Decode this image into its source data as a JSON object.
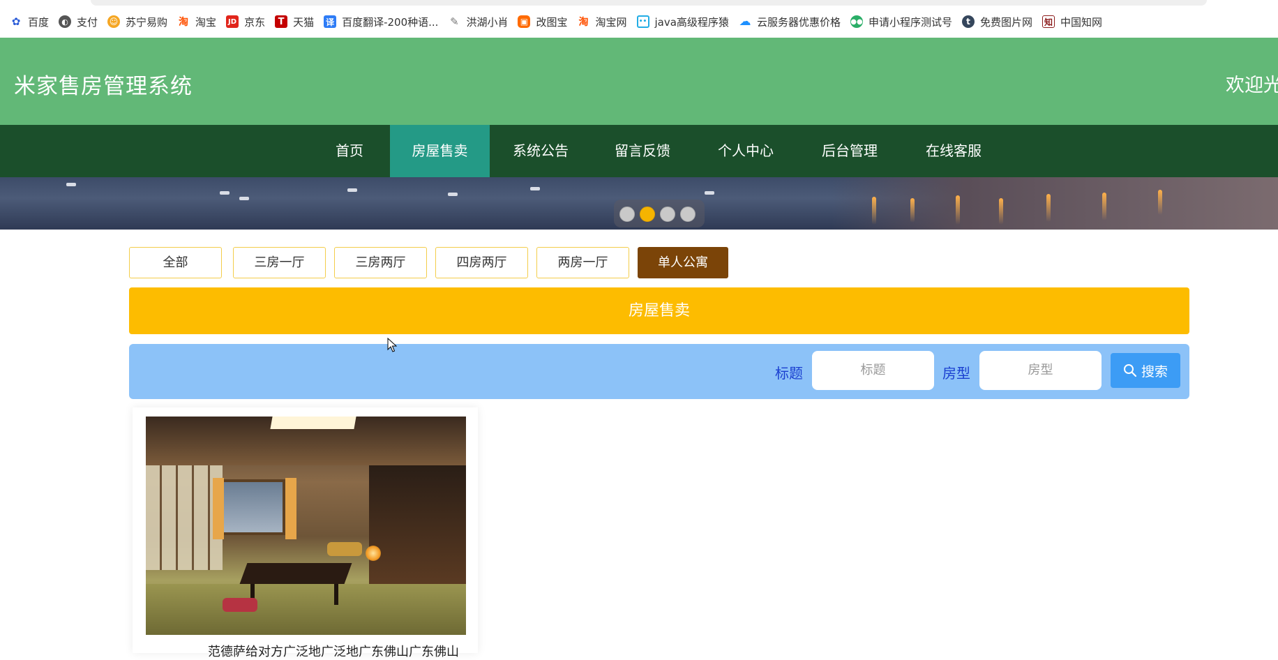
{
  "bookmarks": [
    {
      "label": "百度",
      "icon": "baidu-paw-icon",
      "color": "#2a5bd7"
    },
    {
      "label": "支付",
      "icon": "globe-icon",
      "color": "#555555"
    },
    {
      "label": "苏宁易购",
      "icon": "suning-lion-icon",
      "color": "#f5a623"
    },
    {
      "label": "淘宝",
      "icon": "taobao-icon",
      "color": "#ff5000"
    },
    {
      "label": "京东",
      "icon": "jd-icon",
      "color": "#e1251b"
    },
    {
      "label": "天猫",
      "icon": "tmall-icon",
      "color": "#c40000"
    },
    {
      "label": "百度翻译-200种语...",
      "icon": "translate-icon",
      "color": "#2e7cf6"
    },
    {
      "label": "洪湖小肖",
      "icon": "feather-icon",
      "color": "#777777"
    },
    {
      "label": "改图宝",
      "icon": "gaitubao-icon",
      "color": "#ff6a00"
    },
    {
      "label": "淘宝网",
      "icon": "taobao-icon",
      "color": "#ff5000"
    },
    {
      "label": "java高级程序猿",
      "icon": "bilibili-icon",
      "color": "#23ade5"
    },
    {
      "label": "云服务器优惠价格",
      "icon": "cloud-icon",
      "color": "#1e90ff"
    },
    {
      "label": "申请小程序测试号",
      "icon": "wechat-icon",
      "color": "#2aae67"
    },
    {
      "label": "免费图片网",
      "icon": "tumblr-icon",
      "color": "#35465c"
    },
    {
      "label": "中国知网",
      "icon": "cnki-icon",
      "color": "#8b1a1a"
    }
  ],
  "header": {
    "site_title": "米家售房管理系统",
    "welcome": "欢迎光"
  },
  "nav": {
    "items": [
      "首页",
      "房屋售卖",
      "系统公告",
      "留言反馈",
      "个人中心",
      "后台管理",
      "在线客服"
    ],
    "active": "房屋售卖"
  },
  "carousel": {
    "slides": 4,
    "active_index": 1
  },
  "categories": {
    "items": [
      "全部",
      "三房一厅",
      "三房两厅",
      "四房两厅",
      "两房一厅",
      "单人公寓"
    ],
    "active": "单人公寓"
  },
  "section": {
    "title": "房屋售卖"
  },
  "search": {
    "title_label": "标题",
    "title_placeholder": "标题",
    "type_label": "房型",
    "type_placeholder": "房型",
    "button_label": "搜索"
  },
  "listings": [
    {
      "title": "范德萨给对方广泛地广泛地广东佛山广东佛山",
      "photo": "japanese-tatami-room-photo"
    }
  ],
  "colors": {
    "header_bg": "#62b877",
    "nav_bg": "#1b4f2b",
    "nav_active": "#249a86",
    "section_bar": "#fdbc00",
    "search_bar": "#8cc2f8",
    "search_button": "#3c9cf5",
    "category_active": "#7b4408",
    "carousel_dot_active": "#f5b400"
  }
}
